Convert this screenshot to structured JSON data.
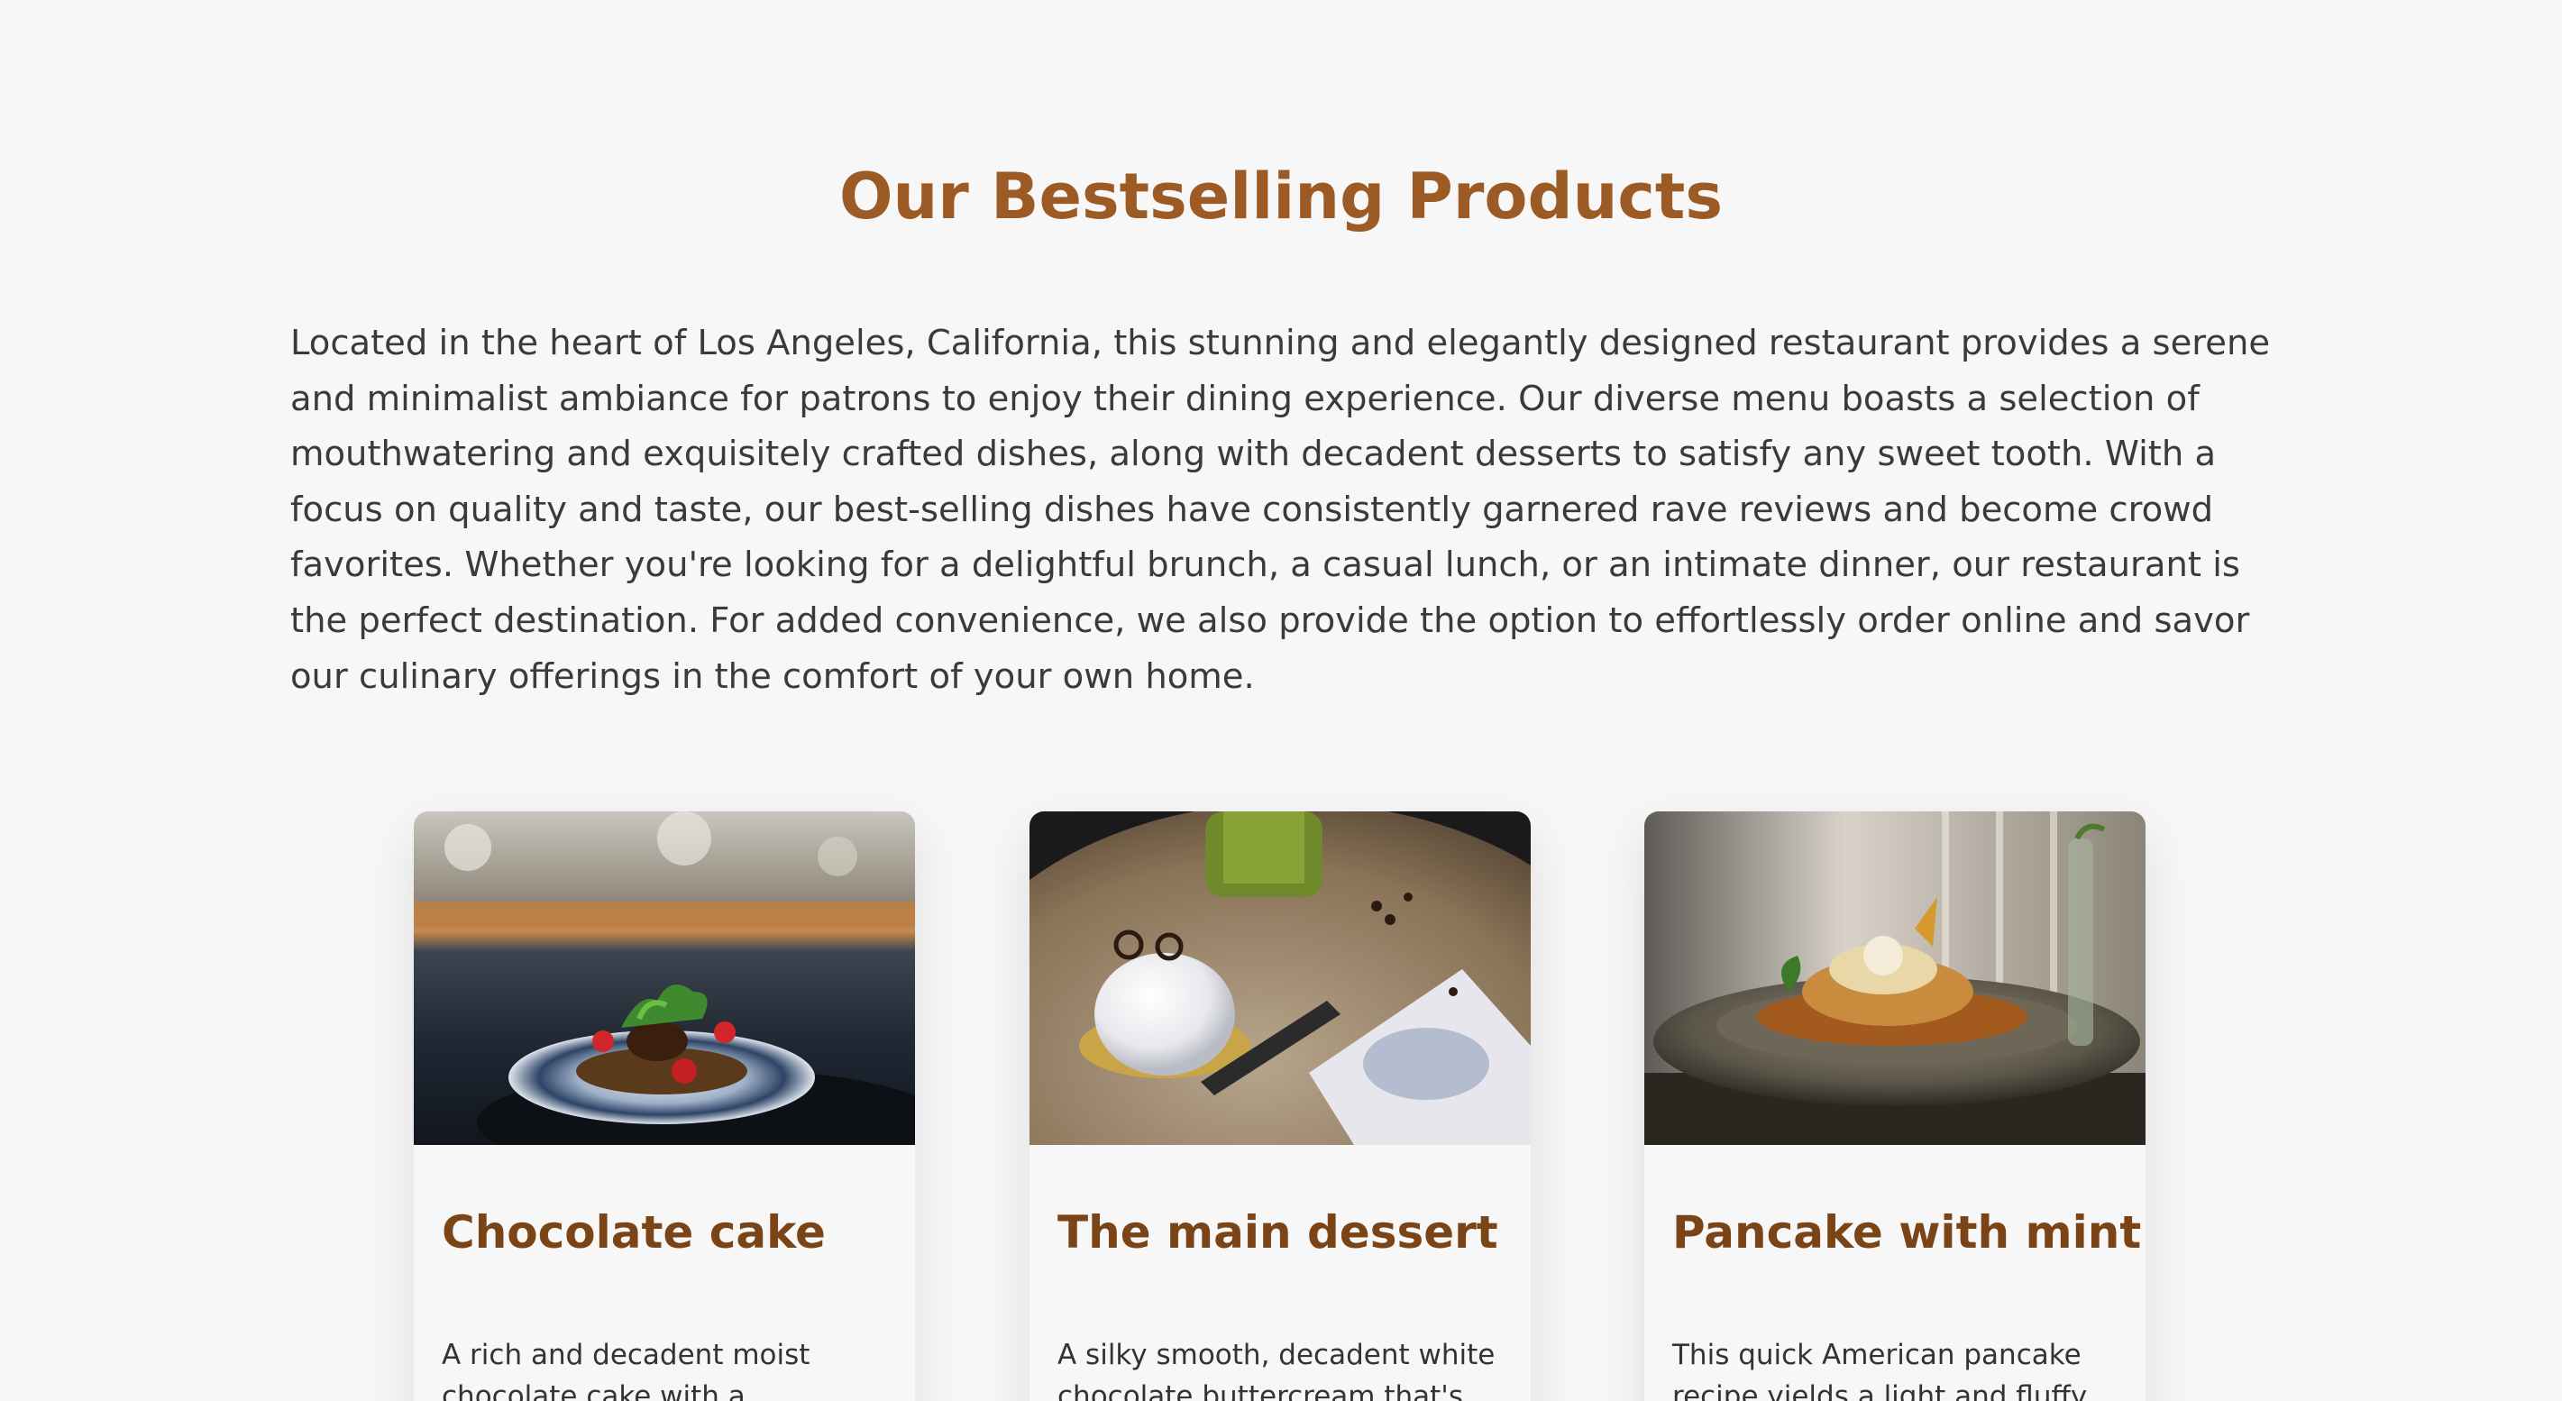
{
  "section": {
    "title": "Our Bestselling Products",
    "intro": "Located in the heart of Los Angeles, California, this stunning and elegantly designed restaurant provides a serene and minimalist ambiance for patrons to enjoy their dining experience. Our diverse menu boasts a selection of mouthwatering and exquisitely crafted dishes, along with decadent desserts to satisfy any sweet tooth. With a focus on quality and taste, our best-selling dishes have consistently garnered rave reviews and become crowd favorites. Whether you're looking for a delightful brunch, a casual lunch, or an intimate dinner, our restaurant is the perfect destination. For added convenience, we also provide the option to effortlessly order online and savor our culinary offerings in the comfort of your own home."
  },
  "products": [
    {
      "title": "Chocolate cake",
      "description": "A rich and decadent moist chocolate cake with a raspberry",
      "image": "plated-waffle-with-greens-photo"
    },
    {
      "title": "The main dessert",
      "description": "A silky smooth, decadent white chocolate buttercream that's",
      "image": "white-mousse-dessert-photo"
    },
    {
      "title": "Pancake with mint",
      "description": "This quick American pancake recipe yields a light and fluffy",
      "image": "pancake-bowl-with-mint-photo"
    }
  ],
  "colors": {
    "background": "#f7f7f7",
    "title": "#9c5a25",
    "card_title": "#7a4416",
    "text": "#333333"
  }
}
